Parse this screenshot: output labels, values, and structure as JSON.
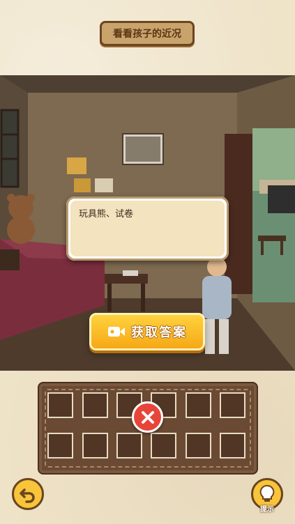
{
  "header": {
    "title": "看看孩子的近况"
  },
  "dialog": {
    "text": "玩具熊、试卷"
  },
  "answer_button": {
    "label": "获取答案",
    "icon": "video-camera-icon"
  },
  "answer_tray": {
    "rows": 2,
    "columns": 6,
    "filled_slots": 0
  },
  "controls": {
    "back_icon": "undo-arrow-icon",
    "close_icon": "close-x-icon",
    "hint_icon": "lightbulb-icon",
    "hint_label": "提示"
  },
  "colors": {
    "background": "#efe3c8",
    "accent_yellow": "#f8c53a",
    "button_orange": "#f6a816",
    "close_red": "#e8453a",
    "tray_brown": "#6b4a33"
  }
}
